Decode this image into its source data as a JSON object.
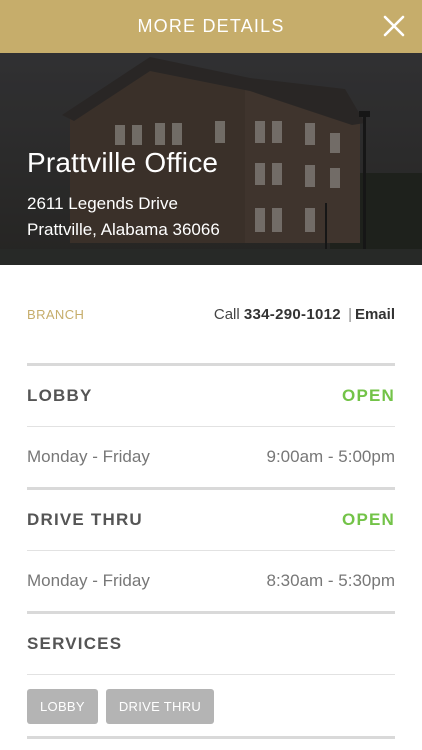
{
  "header": {
    "title": "MORE DETAILS",
    "close_icon": "close-icon"
  },
  "office": {
    "name": "Prattville Office",
    "address_line1": "2611 Legends Drive",
    "address_line2": "Prattville, Alabama 36066"
  },
  "branch": {
    "label": "BRANCH",
    "call_prefix": "Call",
    "phone": "334-290-1012",
    "separator": "|",
    "email_label": "Email"
  },
  "lobby": {
    "title": "LOBBY",
    "status": "OPEN",
    "days": "Monday - Friday",
    "hours": "9:00am - 5:00pm"
  },
  "drive_thru": {
    "title": "DRIVE THRU",
    "status": "OPEN",
    "days": "Monday - Friday",
    "hours": "8:30am - 5:30pm"
  },
  "services": {
    "title": "SERVICES",
    "tags": [
      "LOBBY",
      "DRIVE THRU"
    ]
  },
  "colors": {
    "accent_gold": "#c6ad6b",
    "open_green": "#73c348",
    "tag_gray": "#b4b4b4"
  }
}
